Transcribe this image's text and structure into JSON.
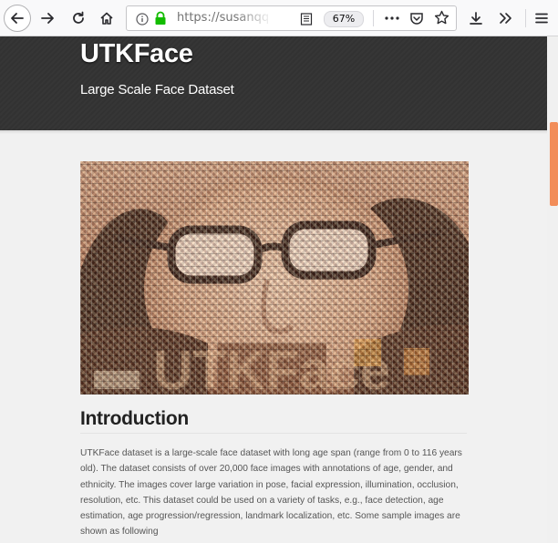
{
  "browser": {
    "url": "https://susanqq",
    "zoom": "67%",
    "icons": [
      "back-arrow-icon",
      "forward-arrow-icon",
      "reload-icon",
      "home-icon",
      "info-icon",
      "lock-icon",
      "reader-view-icon",
      "more-icon",
      "pocket-icon",
      "bookmark-star-icon",
      "download-icon",
      "overflow-icon",
      "menu-icon"
    ]
  },
  "header": {
    "title": "UTKFace",
    "subtitle": "Large Scale Face Dataset"
  },
  "main": {
    "section_heading": "Introduction",
    "intro_text": "UTKFace dataset is a large-scale face dataset with long age span (range from 0 to 116 years old). The dataset consists of over 20,000 face images with annotations of age, gender, and ethnicity. The images cover large variation in pose, facial expression, illumination, occlusion, resolution, etc. This dataset could be used on a variety of tasks, e.g., face detection, age estimation, age progression/regression, landmark localization, etc. Some sample images are shown as following"
  },
  "colors": {
    "header_bg": "#333333",
    "scroll_thumb": "#f28d59",
    "lock_green": "#12bc00"
  }
}
